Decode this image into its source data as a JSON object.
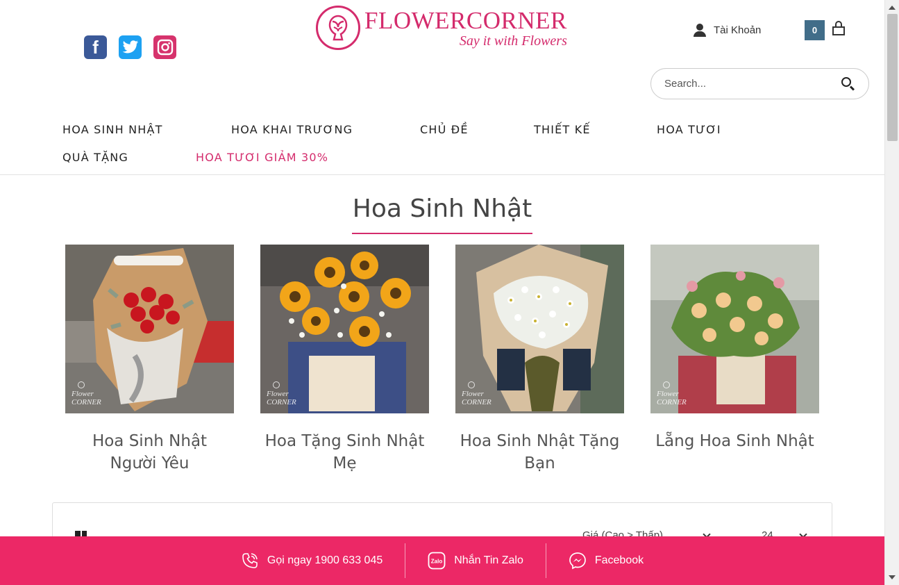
{
  "header": {
    "social": [
      "facebook-icon",
      "twitter-icon",
      "instagram-icon"
    ],
    "logo": {
      "brand": "FLOWERCORNER",
      "tagline": "Say it with Flowers"
    },
    "account_label": "Tài Khoản",
    "cart_count": "0",
    "search_placeholder": "Search..."
  },
  "nav": {
    "items": [
      "HOA SINH NHẬT",
      "HOA KHAI TRƯƠNG",
      "CHỦ ĐỀ",
      "THIẾT KẾ",
      "HOA TƯƠI",
      "QUÀ TẶNG",
      "HOA TƯƠI GIẢM 30%"
    ]
  },
  "section": {
    "title": "Hoa Sinh Nhật"
  },
  "categories": [
    {
      "title": "Hoa Sinh Nhật Người Yêu"
    },
    {
      "title": "Hoa Tặng Sinh Nhật Mẹ"
    },
    {
      "title": "Hoa Sinh Nhật Tặng Bạn"
    },
    {
      "title": "Lẵng Hoa Sinh Nhật"
    }
  ],
  "watermark": {
    "line1": "Flower",
    "line2": "CORNER"
  },
  "toolbar": {
    "sort_value": "Giá (Cao > Thấp)",
    "per_page_value": "24"
  },
  "bottom_bar": {
    "call_label": "Gọi ngay 1900 633 045",
    "zalo_label": "Nhắn Tin Zalo",
    "zalo_icon_text": "Zalo",
    "facebook_label": "Facebook"
  },
  "colors": {
    "brand_pink": "#ec2866",
    "logo_pink": "#d42b6c",
    "cart_badge": "#416d89"
  }
}
